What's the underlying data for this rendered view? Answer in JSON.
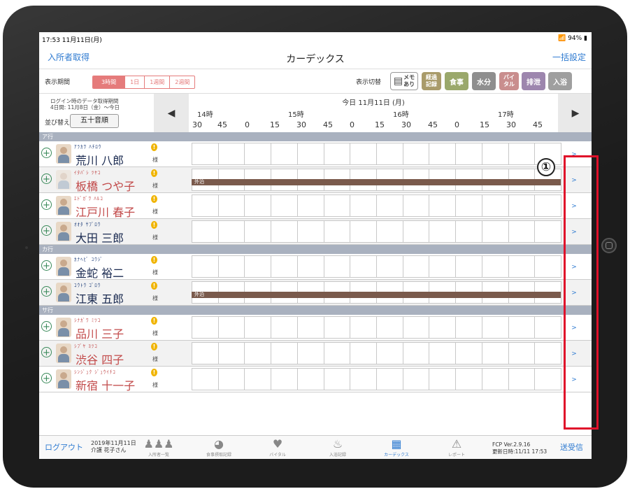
{
  "status_bar": {
    "time": "17:53  11月11日(月)",
    "right": "94%"
  },
  "nav": {
    "left": "入所者取得",
    "title": "カーデックス",
    "right": "一括設定"
  },
  "toolbar": {
    "period_label": "表示期間",
    "periods": [
      "3時間",
      "1日",
      "1週間",
      "2週間"
    ],
    "toggle_label": "表示切替",
    "buttons": {
      "memo": "メモ\nあり",
      "keika": "経過\n記録",
      "meal": "食事",
      "water": "水分",
      "vital": "バイ\nタル",
      "haisetsu": "排泄",
      "bath": "入浴"
    }
  },
  "timeline": {
    "info_line1": "ログイン時のデータ取得期間",
    "info_line2": "4日間: 11月8日（金）～今日",
    "sort_label": "並び替え",
    "sort_value": "五十音順",
    "date_title": "今日 11月11日 (月)",
    "hours": [
      "14時",
      "15時",
      "16時",
      "17時"
    ],
    "minutes": [
      "30",
      "45",
      "0",
      "15",
      "30",
      "45",
      "0",
      "15",
      "30",
      "45",
      "0",
      "15",
      "30",
      "45"
    ]
  },
  "sections": {
    "a": "ア行",
    "ka": "カ行",
    "sa": "サ行"
  },
  "residents": [
    {
      "kana": "ｱﾗｶﾜ ﾊﾁﾛｳ",
      "name": "荒川 八郎",
      "sama": "様"
    },
    {
      "kana": "ｲﾀﾊﾞｼ ﾂﾔｺ",
      "name": "板橋 つや子",
      "sama": "様",
      "away": "外泊"
    },
    {
      "kana": "ｴﾄﾞｶﾞﾜ ﾊﾙｺ",
      "name": "江戸川 春子",
      "sama": "様"
    },
    {
      "kana": "ｵｵﾀ ｻﾌﾞﾛｳ",
      "name": "大田 三郎",
      "sama": "様"
    },
    {
      "kana": "ｶﾅﾍﾋﾞ ﾕｳｼﾞ",
      "name": "金蛇 裕二",
      "sama": "様"
    },
    {
      "kana": "ｺｳﾄｳ ｺﾞﾛｳ",
      "name": "江東 五郎",
      "sama": "様",
      "away": "外泊"
    },
    {
      "kana": "ｼﾅｶﾞﾜ ﾐﾂｺ",
      "name": "品川 三子",
      "sama": "様"
    },
    {
      "kana": "ｼﾌﾞﾔ ﾖﾂｺ",
      "name": "渋谷 四子",
      "sama": "様"
    },
    {
      "kana": "ｼﾝｼﾞｭｸ ｼﾞｭｳｲﾁｺ",
      "name": "新宿 十一子",
      "sama": "様"
    }
  ],
  "go_label": ">",
  "warn_glyph": "!",
  "callout": "①",
  "tabbar": {
    "logout": "ログアウト",
    "date_line1": "2019年11月11日",
    "date_line2": "介護 花子さん",
    "tabs": [
      "入所者一覧",
      "食事摂取記録",
      "バイタル",
      "入浴記録",
      "カーデックス",
      "レポート"
    ],
    "version_line1": "FCP Ver.2.9.16",
    "version_line2": "更新日時:11/11 17:53",
    "send": "送受信"
  },
  "colors": {
    "accent": "#2f7bd1",
    "annotation": "#e0102a",
    "away_bar": "#7a5a4c"
  }
}
